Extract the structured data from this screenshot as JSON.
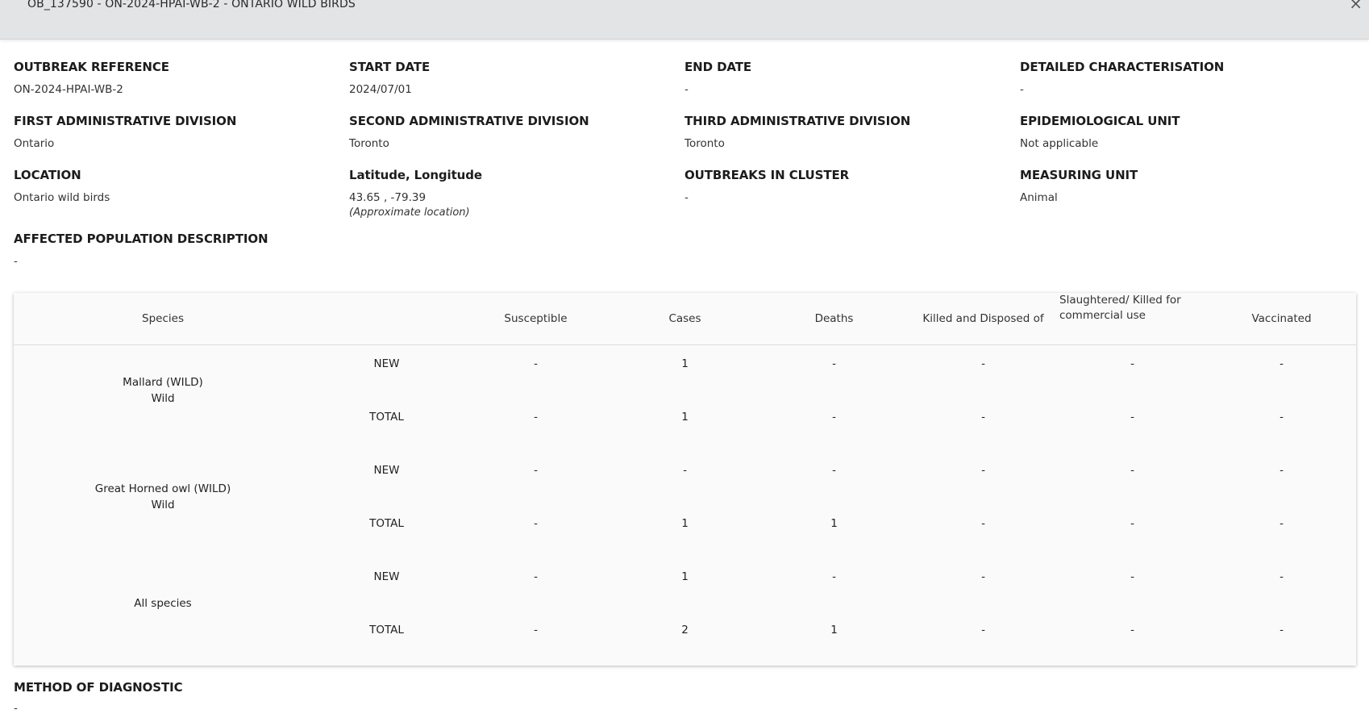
{
  "header": {
    "title": "OB_137590 - ON-2024-HPAI-WB-2 - ONTARIO WILD BIRDS",
    "close_label": "×"
  },
  "fields": {
    "outbreak_reference": {
      "label": "OUTBREAK REFERENCE",
      "value": "ON-2024-HPAI-WB-2"
    },
    "start_date": {
      "label": "START DATE",
      "value": "2024/07/01"
    },
    "end_date": {
      "label": "END DATE",
      "value": "-"
    },
    "detailed_characterisation": {
      "label": "DETAILED CHARACTERISATION",
      "value": "-"
    },
    "first_admin_division": {
      "label": "FIRST ADMINISTRATIVE DIVISION",
      "value": "Ontario"
    },
    "second_admin_division": {
      "label": "SECOND ADMINISTRATIVE DIVISION",
      "value": "Toronto"
    },
    "third_admin_division": {
      "label": "THIRD ADMINISTRATIVE DIVISION",
      "value": "Toronto"
    },
    "epidemiological_unit": {
      "label": "EPIDEMIOLOGICAL UNIT",
      "value": "Not applicable"
    },
    "location": {
      "label": "LOCATION",
      "value": "Ontario wild birds"
    },
    "lat_long": {
      "label": "Latitude, Longitude",
      "value": "43.65 , -79.39",
      "note": "(Approximate location)"
    },
    "outbreaks_in_cluster": {
      "label": "OUTBREAKS IN CLUSTER",
      "value": "-"
    },
    "measuring_unit": {
      "label": "MEASURING UNIT",
      "value": "Animal"
    },
    "affected_population": {
      "label": "AFFECTED POPULATION DESCRIPTION",
      "value": "-"
    },
    "method_of_diagnostic": {
      "label": "METHOD OF DIAGNOSTIC",
      "value": "-"
    }
  },
  "table": {
    "headers": {
      "species": "Species",
      "susceptible": "Susceptible",
      "cases": "Cases",
      "deaths": "Deaths",
      "killed_disposed": "Killed and Disposed of",
      "slaughtered_line1": "Slaughtered/ Killed for",
      "slaughtered_line2": "commercial use",
      "vaccinated": "Vaccinated"
    },
    "groups": [
      {
        "species_line1": "Mallard (WILD)",
        "species_line2": "Wild",
        "rows": [
          {
            "type": "NEW",
            "susceptible": "-",
            "cases": "1",
            "deaths": "-",
            "killed": "-",
            "slaughtered": "-",
            "vaccinated": "-"
          },
          {
            "type": "TOTAL",
            "susceptible": "-",
            "cases": "1",
            "deaths": "-",
            "killed": "-",
            "slaughtered": "-",
            "vaccinated": "-"
          }
        ]
      },
      {
        "species_line1": "Great Horned owl (WILD)",
        "species_line2": "Wild",
        "rows": [
          {
            "type": "NEW",
            "susceptible": "-",
            "cases": "-",
            "deaths": "-",
            "killed": "-",
            "slaughtered": "-",
            "vaccinated": "-"
          },
          {
            "type": "TOTAL",
            "susceptible": "-",
            "cases": "1",
            "deaths": "1",
            "killed": "-",
            "slaughtered": "-",
            "vaccinated": "-"
          }
        ]
      },
      {
        "species_line1": "All species",
        "species_line2": "",
        "rows": [
          {
            "type": "NEW",
            "susceptible": "-",
            "cases": "1",
            "deaths": "-",
            "killed": "-",
            "slaughtered": "-",
            "vaccinated": "-"
          },
          {
            "type": "TOTAL",
            "susceptible": "-",
            "cases": "2",
            "deaths": "1",
            "killed": "-",
            "slaughtered": "-",
            "vaccinated": "-"
          }
        ]
      }
    ]
  }
}
